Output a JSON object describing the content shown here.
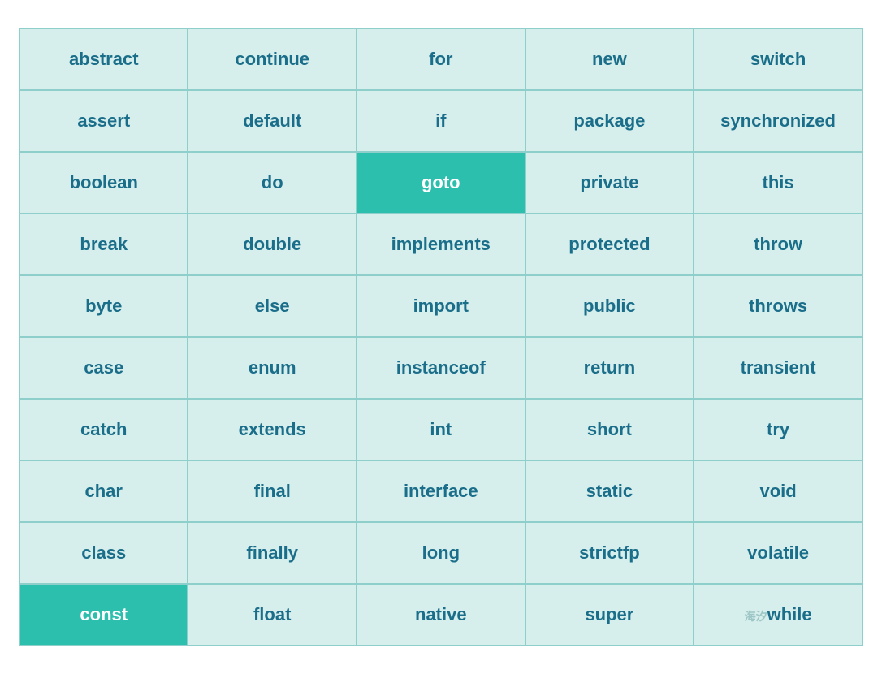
{
  "table": {
    "rows": [
      [
        {
          "text": "abstract",
          "highlight": false
        },
        {
          "text": "continue",
          "highlight": false
        },
        {
          "text": "for",
          "highlight": false
        },
        {
          "text": "new",
          "highlight": false
        },
        {
          "text": "switch",
          "highlight": false
        }
      ],
      [
        {
          "text": "assert",
          "highlight": false
        },
        {
          "text": "default",
          "highlight": false
        },
        {
          "text": "if",
          "highlight": false
        },
        {
          "text": "package",
          "highlight": false
        },
        {
          "text": "synchronized",
          "highlight": false
        }
      ],
      [
        {
          "text": "boolean",
          "highlight": false
        },
        {
          "text": "do",
          "highlight": false
        },
        {
          "text": "goto",
          "highlight": true
        },
        {
          "text": "private",
          "highlight": false
        },
        {
          "text": "this",
          "highlight": false
        }
      ],
      [
        {
          "text": "break",
          "highlight": false
        },
        {
          "text": "double",
          "highlight": false
        },
        {
          "text": "implements",
          "highlight": false
        },
        {
          "text": "protected",
          "highlight": false
        },
        {
          "text": "throw",
          "highlight": false
        }
      ],
      [
        {
          "text": "byte",
          "highlight": false
        },
        {
          "text": "else",
          "highlight": false
        },
        {
          "text": "import",
          "highlight": false
        },
        {
          "text": "public",
          "highlight": false
        },
        {
          "text": "throws",
          "highlight": false
        }
      ],
      [
        {
          "text": "case",
          "highlight": false
        },
        {
          "text": "enum",
          "highlight": false
        },
        {
          "text": "instanceof",
          "highlight": false
        },
        {
          "text": "return",
          "highlight": false
        },
        {
          "text": "transient",
          "highlight": false
        }
      ],
      [
        {
          "text": "catch",
          "highlight": false
        },
        {
          "text": "extends",
          "highlight": false
        },
        {
          "text": "int",
          "highlight": false
        },
        {
          "text": "short",
          "highlight": false
        },
        {
          "text": "try",
          "highlight": false
        }
      ],
      [
        {
          "text": "char",
          "highlight": false
        },
        {
          "text": "final",
          "highlight": false
        },
        {
          "text": "interface",
          "highlight": false
        },
        {
          "text": "static",
          "highlight": false
        },
        {
          "text": "void",
          "highlight": false
        }
      ],
      [
        {
          "text": "class",
          "highlight": false
        },
        {
          "text": "finally",
          "highlight": false
        },
        {
          "text": "long",
          "highlight": false
        },
        {
          "text": "strictfp",
          "highlight": false
        },
        {
          "text": "volatile",
          "highlight": false
        }
      ],
      [
        {
          "text": "const",
          "highlight": true
        },
        {
          "text": "float",
          "highlight": false
        },
        {
          "text": "native",
          "highlight": false
        },
        {
          "text": "super",
          "highlight": false
        },
        {
          "text": "while",
          "highlight": false,
          "watermark": true
        }
      ]
    ]
  }
}
